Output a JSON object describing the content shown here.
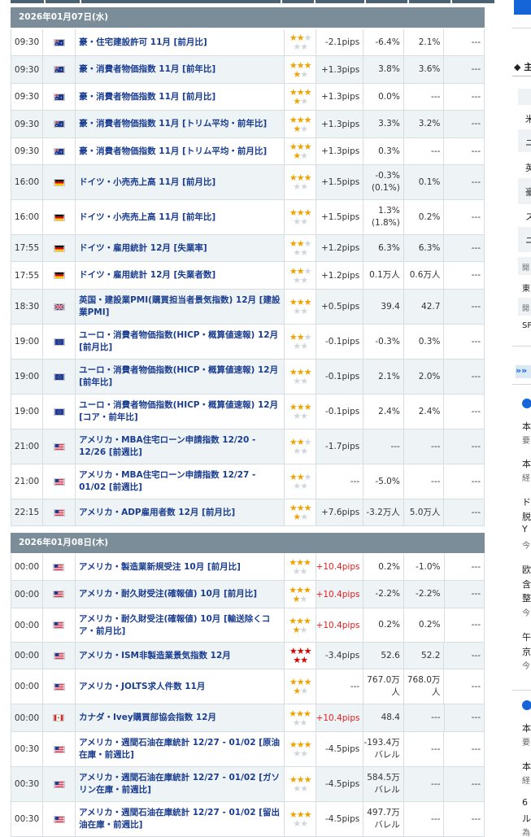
{
  "days": [
    {
      "date": "2026年01月07日(水)",
      "rows": [
        {
          "time": "09:30",
          "flag": "au",
          "name": "豪・住宅建設許可 11月 [前月比]",
          "stars": 2,
          "red": false,
          "volatility": "-2.1pips",
          "result": "-6.4%",
          "forecast": "2.1%",
          "previous": "---"
        },
        {
          "time": "09:30",
          "flag": "au",
          "name": "豪・消費者物価指数 11月 [前年比]",
          "stars": 4,
          "red": false,
          "volatility": "+1.3pips",
          "result": "3.8%",
          "forecast": "3.6%",
          "previous": "---"
        },
        {
          "time": "09:30",
          "flag": "au",
          "name": "豪・消費者物価指数 11月 [前月比]",
          "stars": 4,
          "red": false,
          "volatility": "+1.3pips",
          "result": "0.0%",
          "forecast": "---",
          "previous": "---"
        },
        {
          "time": "09:30",
          "flag": "au",
          "name": "豪・消費者物価指数 11月 [トリム平均・前年比]",
          "stars": 4,
          "red": false,
          "volatility": "+1.3pips",
          "result": "3.3%",
          "forecast": "3.2%",
          "previous": "---"
        },
        {
          "time": "09:30",
          "flag": "au",
          "name": "豪・消費者物価指数 11月 [トリム平均・前月比]",
          "stars": 4,
          "red": false,
          "volatility": "+1.3pips",
          "result": "0.3%",
          "forecast": "---",
          "previous": "---"
        },
        {
          "time": "16:00",
          "flag": "de",
          "name": "ドイツ・小売売上高 11月 [前月比]",
          "stars": 3,
          "red": false,
          "volatility": "+1.5pips",
          "result": "-0.3%\n(0.1%)",
          "forecast": "0.1%",
          "previous": "---"
        },
        {
          "time": "16:00",
          "flag": "de",
          "name": "ドイツ・小売売上高 11月 [前年比]",
          "stars": 3,
          "red": false,
          "volatility": "+1.5pips",
          "result": "1.3%\n(1.8%)",
          "forecast": "0.2%",
          "previous": "---"
        },
        {
          "time": "17:55",
          "flag": "de",
          "name": "ドイツ・雇用統計 12月 [失業率]",
          "stars": 2,
          "red": false,
          "volatility": "+1.2pips",
          "result": "6.3%",
          "forecast": "6.3%",
          "previous": "---"
        },
        {
          "time": "17:55",
          "flag": "de",
          "name": "ドイツ・雇用統計 12月 [失業者数]",
          "stars": 2,
          "red": false,
          "volatility": "+1.2pips",
          "result": "0.1万人",
          "forecast": "0.6万人",
          "previous": "---"
        },
        {
          "time": "18:30",
          "flag": "gb",
          "name": "英国・建設業PMI(購買担当者景気指数) 12月 [建設業PMI]",
          "stars": 3,
          "red": false,
          "volatility": "+0.5pips",
          "result": "39.4",
          "forecast": "42.7",
          "previous": "---"
        },
        {
          "time": "19:00",
          "flag": "eu",
          "name": "ユーロ・消費者物価指数(HICP・概算値速報) 12月 [前月比]",
          "stars": 2,
          "red": false,
          "volatility": "-0.1pips",
          "result": "-0.3%",
          "forecast": "0.3%",
          "previous": "---"
        },
        {
          "time": "19:00",
          "flag": "eu",
          "name": "ユーロ・消費者物価指数(HICP・概算値速報) 12月 [前年比]",
          "stars": 3,
          "red": false,
          "volatility": "-0.1pips",
          "result": "2.1%",
          "forecast": "2.0%",
          "previous": "---"
        },
        {
          "time": "19:00",
          "flag": "eu",
          "name": "ユーロ・消費者物価指数(HICP・概算値速報) 12月 [コア・前年比]",
          "stars": 3,
          "red": false,
          "volatility": "-0.1pips",
          "result": "2.4%",
          "forecast": "2.4%",
          "previous": "---"
        },
        {
          "time": "21:00",
          "flag": "us",
          "name": "アメリカ・MBA住宅ローン申請指数 12/20 - 12/26 [前週比]",
          "stars": 2,
          "red": false,
          "volatility": "-1.7pips",
          "result": "---",
          "forecast": "---",
          "previous": "---"
        },
        {
          "time": "21:00",
          "flag": "us",
          "name": "アメリカ・MBA住宅ローン申請指数 12/27 - 01/02 [前週比]",
          "stars": 2,
          "red": false,
          "volatility": "---",
          "result": "-5.0%",
          "forecast": "---",
          "previous": "---"
        },
        {
          "time": "22:15",
          "flag": "us",
          "name": "アメリカ・ADP雇用者数 12月 [前月比]",
          "stars": 4,
          "red": false,
          "volatility": "+7.6pips",
          "result": "-3.2万人",
          "forecast": "5.0万人",
          "previous": "---"
        }
      ]
    },
    {
      "date": "2026年01月08日(木)",
      "rows": [
        {
          "time": "00:00",
          "flag": "us",
          "name": "アメリカ・製造業新規受注 10月 [前月比]",
          "stars": 3,
          "red": false,
          "volatility": "+10.4pips",
          "volred": true,
          "result": "0.2%",
          "forecast": "-1.0%",
          "previous": "---"
        },
        {
          "time": "00:00",
          "flag": "us",
          "name": "アメリカ・耐久財受注(確報値) 10月 [前月比]",
          "stars": 4,
          "red": false,
          "volatility": "+10.4pips",
          "volred": true,
          "result": "-2.2%",
          "forecast": "-2.2%",
          "previous": "---"
        },
        {
          "time": "00:00",
          "flag": "us",
          "name": "アメリカ・耐久財受注(確報値) 10月 [輸送除くコア・前月比]",
          "stars": 4,
          "red": false,
          "volatility": "+10.4pips",
          "volred": true,
          "result": "0.2%",
          "forecast": "0.2%",
          "previous": "---"
        },
        {
          "time": "00:00",
          "flag": "us",
          "name": "アメリカ・ISM非製造業景気指数 12月",
          "stars": 5,
          "red": true,
          "volatility": "-3.4pips",
          "result": "52.6",
          "forecast": "52.2",
          "previous": "---"
        },
        {
          "time": "00:00",
          "flag": "us",
          "name": "アメリカ・JOLTS求人件数 11月",
          "stars": 4,
          "red": false,
          "volatility": "---",
          "result": "767.0万\n人",
          "forecast": "768.0万\n人",
          "previous": "---"
        },
        {
          "time": "00:00",
          "flag": "ca",
          "name": "カナダ・Ivey購買部協会指数 12月",
          "stars": 3,
          "red": false,
          "volatility": "+10.4pips",
          "volred": true,
          "result": "48.4",
          "forecast": "---",
          "previous": "---"
        },
        {
          "time": "00:30",
          "flag": "us",
          "name": "アメリカ・週間石油在庫統計 12/27 - 01/02 [原油在庫・前週比]",
          "stars": 3,
          "red": false,
          "volatility": "-4.5pips",
          "result": "-193.4万\nバレル",
          "forecast": "---",
          "previous": "---"
        },
        {
          "time": "00:30",
          "flag": "us",
          "name": "アメリカ・週間石油在庫統計 12/27 - 01/02 [ガソリン在庫・前週比]",
          "stars": 3,
          "red": false,
          "volatility": "-4.5pips",
          "result": "584.5万\nバレル",
          "forecast": "---",
          "previous": "---"
        },
        {
          "time": "00:30",
          "flag": "us",
          "name": "アメリカ・週間石油在庫統計 12/27 - 01/02 [留出油在庫・前週比]",
          "stars": 3,
          "red": false,
          "volatility": "-4.5pips",
          "result": "497.7万\nバレル",
          "forecast": "---",
          "previous": "---"
        }
      ]
    }
  ],
  "sidebar": {
    "items": [
      "◆ 主",
      "米",
      "ニ",
      "英",
      "豪",
      "ス",
      "ニ",
      "開",
      "東",
      "開",
      "SP",
      "本",
      "要",
      "本",
      "経",
      "ド",
      "脱",
      "Y",
      "今",
      "欧",
      "含",
      "整",
      "今",
      "午",
      "京",
      "今",
      "本",
      "要",
      "本",
      "経",
      "6",
      "ル",
      "為"
    ]
  }
}
